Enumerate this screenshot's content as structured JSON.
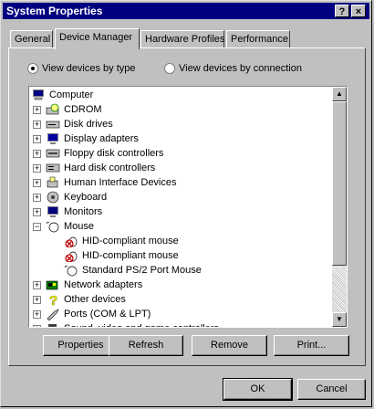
{
  "window": {
    "title": "System Properties",
    "help_label": "?",
    "close_label": "×"
  },
  "tabs": [
    {
      "label": "General"
    },
    {
      "label": "Device Manager",
      "active": true
    },
    {
      "label": "Hardware Profiles"
    },
    {
      "label": "Performance"
    }
  ],
  "view_options": {
    "by_type": "View devices by type",
    "by_connection": "View devices by connection",
    "selected": "by_type"
  },
  "tree": {
    "root": "Computer",
    "items": [
      {
        "label": "CDROM",
        "icon": "cdrom-icon",
        "expanded": false
      },
      {
        "label": "Disk drives",
        "icon": "disk-drive-icon",
        "expanded": false
      },
      {
        "label": "Display adapters",
        "icon": "display-adapter-icon",
        "expanded": false
      },
      {
        "label": "Floppy disk controllers",
        "icon": "floppy-controller-icon",
        "expanded": false
      },
      {
        "label": "Hard disk controllers",
        "icon": "hard-disk-controller-icon",
        "expanded": false
      },
      {
        "label": "Human Interface Devices",
        "icon": "hid-icon",
        "expanded": false
      },
      {
        "label": "Keyboard",
        "icon": "keyboard-icon",
        "expanded": false
      },
      {
        "label": "Monitors",
        "icon": "monitor-icon",
        "expanded": false
      },
      {
        "label": "Mouse",
        "icon": "mouse-icon",
        "expanded": true,
        "children": [
          {
            "label": "HID-compliant mouse",
            "icon": "disabled-mouse-icon"
          },
          {
            "label": "HID-compliant mouse",
            "icon": "disabled-mouse-icon"
          },
          {
            "label": "Standard PS/2 Port Mouse",
            "icon": "mouse-icon"
          }
        ]
      },
      {
        "label": "Network adapters",
        "icon": "network-adapter-icon",
        "expanded": false
      },
      {
        "label": "Other devices",
        "icon": "question-icon",
        "expanded": false
      },
      {
        "label": "Ports (COM & LPT)",
        "icon": "port-icon",
        "expanded": false
      },
      {
        "label": "Sound, video and game controllers",
        "icon": "sound-icon",
        "expanded": false
      }
    ]
  },
  "actions": {
    "properties": "Properties",
    "refresh": "Refresh",
    "remove": "Remove",
    "print": "Print..."
  },
  "dialog": {
    "ok": "OK",
    "cancel": "Cancel"
  }
}
